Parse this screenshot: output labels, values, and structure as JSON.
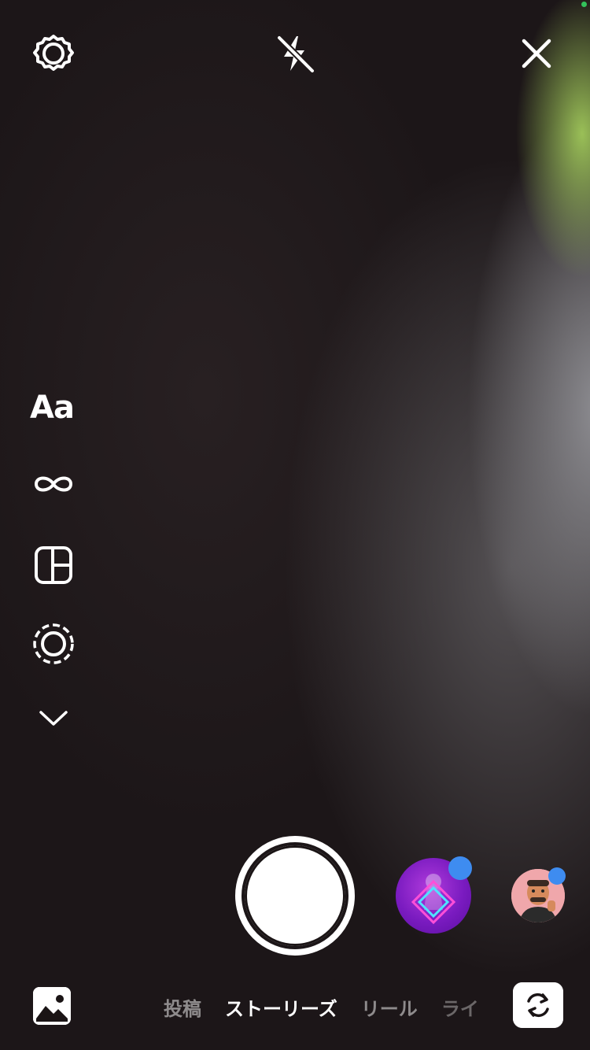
{
  "top_bar": {
    "settings_icon": "settings-icon",
    "flash_icon": "flash-off-icon",
    "close_icon": "close-icon"
  },
  "side_tools": {
    "text_tool_label": "Aa",
    "items": [
      {
        "name": "text-tool",
        "icon": "text-aa"
      },
      {
        "name": "boomerang-tool",
        "icon": "infinity-icon"
      },
      {
        "name": "layout-tool",
        "icon": "layout-grid-icon"
      },
      {
        "name": "handsfree-tool",
        "icon": "dashed-circle-icon"
      },
      {
        "name": "more-tools",
        "icon": "chevron-down-icon"
      }
    ]
  },
  "capture": {
    "shutter": "shutter-button",
    "effects": [
      {
        "name": "effect-thumbnail",
        "has_new_badge": true
      },
      {
        "name": "avatar-effect-thumbnail",
        "has_new_badge": true
      }
    ]
  },
  "modes": {
    "items": [
      "投稿",
      "ストーリーズ",
      "リール",
      "ライ"
    ],
    "active_index": 1
  },
  "bottom_bar": {
    "gallery_icon": "gallery-icon",
    "flip_icon": "camera-flip-icon"
  },
  "colors": {
    "badge_blue": "#3e8cf0",
    "effect_purple": "#7a1bc0",
    "status_green": "#33c25a"
  }
}
